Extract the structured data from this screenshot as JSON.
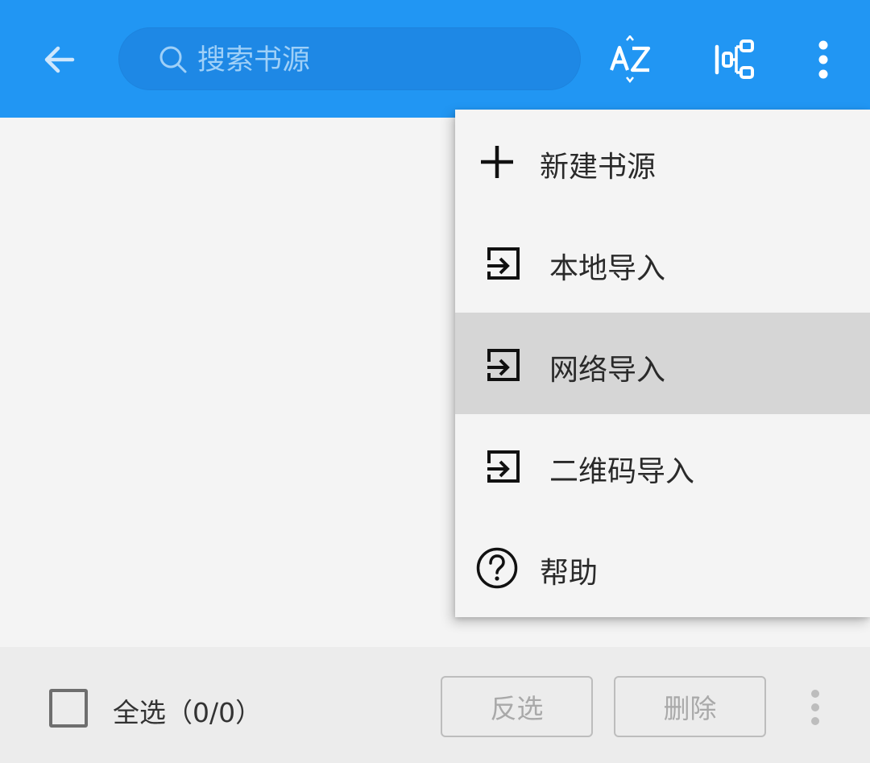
{
  "header": {
    "search_placeholder": "搜索书源",
    "icons": [
      "back-arrow-icon",
      "search-icon",
      "sort-az-icon",
      "group-icon",
      "more-vert-icon"
    ]
  },
  "menu": {
    "items": [
      {
        "label": "新建书源",
        "icon": "plus-icon"
      },
      {
        "label": "本地导入",
        "icon": "import-icon"
      },
      {
        "label": "网络导入",
        "icon": "import-icon",
        "highlighted": true
      },
      {
        "label": "二维码导入",
        "icon": "import-icon"
      },
      {
        "label": "帮助",
        "icon": "help-circle-icon"
      }
    ]
  },
  "footer": {
    "select_all_label": "全选（0/0）",
    "invert_label": "反选",
    "delete_label": "删除"
  },
  "colors": {
    "primary": "#2196f3",
    "search_bg": "#1e88e5",
    "highlight": "#d6d6d6"
  }
}
